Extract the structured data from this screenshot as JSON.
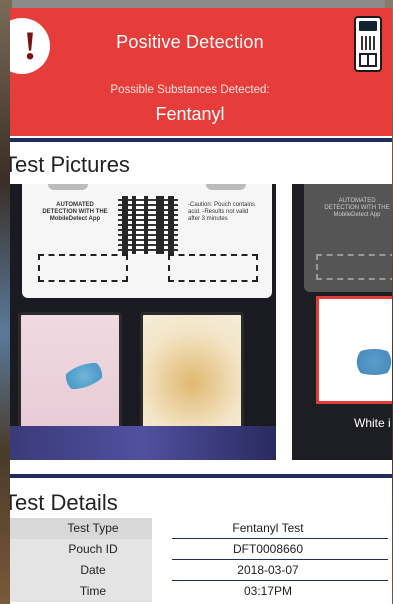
{
  "header": {
    "alert_glyph": "!",
    "title": "Positive Detection",
    "subtitle": "Possible Substances Detected:",
    "substance": "Fentanyl",
    "bg_color": "#e73d3a"
  },
  "sections": {
    "pictures_title": "Test Pictures",
    "details_title": "Test Details"
  },
  "pictures": [
    {
      "card_left_text": "AUTOMATED DETECTION WITH THE MobileDetect App",
      "card_right_text": "-Caution: Pouch contains acid. -Results not valid after 3 minutes"
    },
    {
      "card_text": "AUTOMATED DETECTION WITH THE MobileDetect App",
      "caption": "White i"
    }
  ],
  "details": [
    {
      "label": "Test Type",
      "value": "Fentanyl Test"
    },
    {
      "label": "Pouch ID",
      "value": "DFT0008660"
    },
    {
      "label": "Date",
      "value": "2018-03-07"
    },
    {
      "label": "Time",
      "value": "03:17PM"
    }
  ],
  "colors": {
    "accent": "#e73d3a",
    "navy": "#1f2d5a"
  }
}
